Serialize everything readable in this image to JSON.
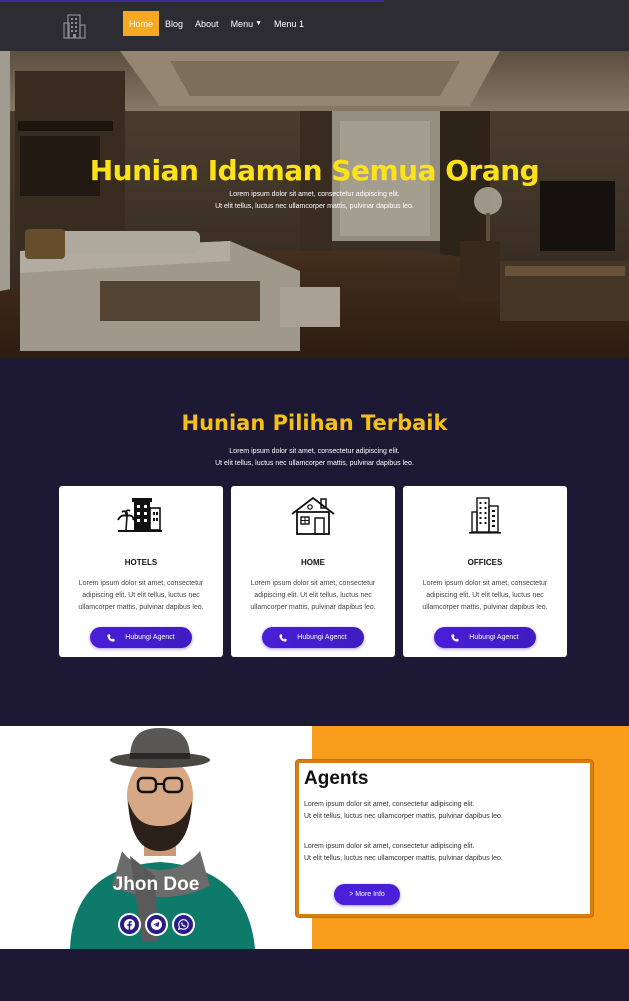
{
  "nav": {
    "items": [
      {
        "label": "Home",
        "active": true
      },
      {
        "label": "Blog",
        "active": false
      },
      {
        "label": "About",
        "active": false
      },
      {
        "label": "Menu",
        "active": false,
        "has_caret": true
      },
      {
        "label": "Menu 1",
        "active": false
      }
    ]
  },
  "hero": {
    "title": "Hunian Idaman Semua Orang",
    "line1": "Lorem ipsum dolor sit amet, consectetur adipiscing elit.",
    "line2": "Ut elit tellus, luctus nec ullamcorper mattis, pulvinar dapibus leo."
  },
  "services": {
    "title": "Hunian Pilihan Terbaik",
    "line1": "Lorem ipsum dolor sit amet, consectetur adipiscing elit.",
    "line2": "Ut elit tellus, luctus nec ullamcorper mattis, pulvinar dapibus leo.",
    "cards": [
      {
        "icon": "hotel-icon",
        "title": "HOTELS",
        "text": "Lorem ipsum dolor sit amet, consectetur adipiscing elit. Ut elit tellus, luctus nec ullamcorper mattis, pulvinar dapibus leo.",
        "button": "Hubungi Agenct"
      },
      {
        "icon": "house-icon",
        "title": "HOME",
        "text": "Lorem ipsum dolor sit amet, consectetur adipiscing elit. Ut elit tellus, luctus nec ullamcorper mattis, pulvinar dapibus leo.",
        "button": "Hubungi Agenct"
      },
      {
        "icon": "office-building-icon",
        "title": "OFFICES",
        "text": "Lorem ipsum dolor sit amet, consectetur adipiscing elit. Ut elit tellus, luctus nec ullamcorper mattis, pulvinar dapibus leo.",
        "button": "Hubungi Agenct"
      }
    ]
  },
  "agents": {
    "name": "Jhon Doe",
    "title": "Agents",
    "para1_line1": "Lorem ipsum dolor sit amet, consectetur adipiscing elit.",
    "para1_line2": "Ut elit tellus, luctus nec ullamcorper mattis, pulvinar dapibus leo.",
    "para2_line1": "Lorem ipsum dolor sit amet, consectetur adipiscing elit.",
    "para2_line2": "Ut elit tellus, luctus nec ullamcorper mattis, pulvinar dapibus leo.",
    "more_button": "> More Info",
    "socials": [
      "facebook-icon",
      "telegram-icon",
      "whatsapp-icon"
    ]
  },
  "colors": {
    "accent": "#f7a823",
    "hero_title": "#fde21a",
    "dark_bg": "#1d1834",
    "button": "#4a1fd9",
    "agents_bg": "#f99e1c"
  }
}
